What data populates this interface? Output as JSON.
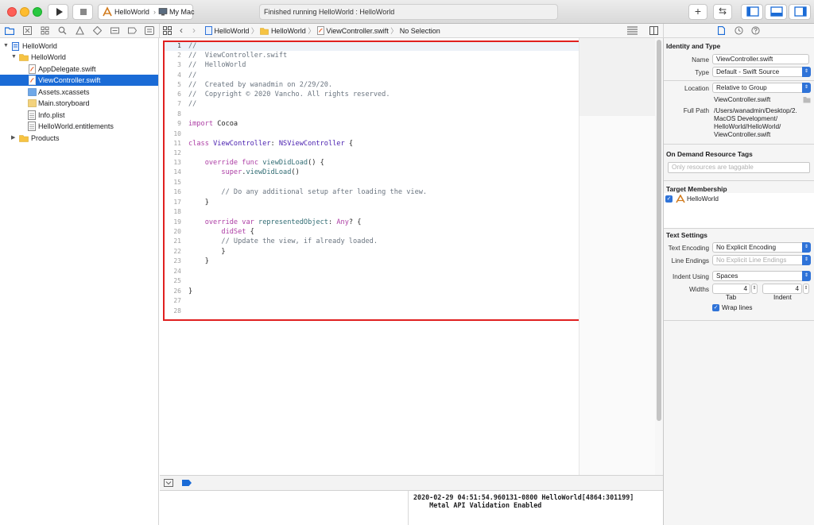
{
  "toolbar": {
    "scheme": "HelloWorld",
    "destination": "My Mac",
    "status": "Finished running HelloWorld : HelloWorld",
    "add_label": "+",
    "arrows_label": "⇆"
  },
  "jumpbar": {
    "crumbs": [
      "HelloWorld",
      "HelloWorld",
      "ViewController.swift",
      "No Selection"
    ]
  },
  "navigator": {
    "items": [
      {
        "label": "HelloWorld"
      },
      {
        "label": "HelloWorld"
      },
      {
        "label": "AppDelegate.swift"
      },
      {
        "label": "ViewController.swift"
      },
      {
        "label": "Assets.xcassets"
      },
      {
        "label": "Main.storyboard"
      },
      {
        "label": "Info.plist"
      },
      {
        "label": "HelloWorld.entitlements"
      },
      {
        "label": "Products"
      }
    ]
  },
  "editor": {
    "line_numbers": [
      "1",
      "2",
      "3",
      "4",
      "5",
      "6",
      "7",
      "8",
      "9",
      "10",
      "11",
      "12",
      "13",
      "14",
      "15",
      "16",
      "17",
      "18",
      "19",
      "20",
      "21",
      "22",
      "23",
      "24",
      "25",
      "26",
      "27",
      "28"
    ],
    "comments": {
      "l1": "//",
      "l2": "//  ViewController.swift",
      "l3": "//  HelloWorld",
      "l4": "//",
      "l5": "//  Created by wanadmin on 2/29/20.",
      "l6": "//  Copyright © 2020 Vancho. All rights reserved.",
      "l7": "//",
      "l16": "// Do any additional setup after loading the view.",
      "l21": "// Update the view, if already loaded."
    },
    "tokens": {
      "import": "import",
      "cocoa": "Cocoa",
      "class": "class",
      "vc": "ViewController",
      "colon": ": ",
      "nsvc": "NSViewController",
      "brace_open": " {",
      "override": "override",
      "func": "func",
      "viewDidLoad": "viewDidLoad",
      "parens_brace": "() {",
      "super": "super",
      "dot": ".",
      "parens": "()",
      "close": "}",
      "var": "var",
      "representedObject": "representedObject",
      "any": "Any",
      "opt": "? {",
      "didSet": "didSet",
      "colon_sep": ": "
    }
  },
  "console": {
    "line1": "2020-02-29 04:51:54.960131-0800 HelloWorld[4864:301199]",
    "line2": "    Metal API Validation Enabled"
  },
  "inspector": {
    "identity_title": "Identity and Type",
    "name_label": "Name",
    "name_value": "ViewController.swift",
    "type_label": "Type",
    "type_value": "Default - Swift Source",
    "location_label": "Location",
    "location_value": "Relative to Group",
    "location_file": "ViewController.swift",
    "fullpath_label": "Full Path",
    "fullpath_lines": [
      "/Users/wanadmin/Desktop/2.",
      "MacOS Development/",
      "HelloWorld/HelloWorld/",
      "ViewController.swift"
    ],
    "tags_title": "On Demand Resource Tags",
    "tags_placeholder": "Only resources are taggable",
    "membership_title": "Target Membership",
    "membership_target": "HelloWorld",
    "text_settings_title": "Text Settings",
    "encoding_label": "Text Encoding",
    "encoding_value": "No Explicit Encoding",
    "endings_label": "Line Endings",
    "endings_value": "No Explicit Line Endings",
    "indent_using_label": "Indent Using",
    "indent_using_value": "Spaces",
    "widths_label": "Widths",
    "tab_value": "4",
    "indent_value": "4",
    "tab_label": "Tab",
    "indent_label": "Indent",
    "wrap_label": "Wrap lines"
  },
  "colors": {
    "selection": "#1a6bd6",
    "highlight_box": "#e02020",
    "keyword": "#ad3da4",
    "type": "#4b21b0",
    "comment": "#6b7580",
    "function": "#326d74"
  }
}
